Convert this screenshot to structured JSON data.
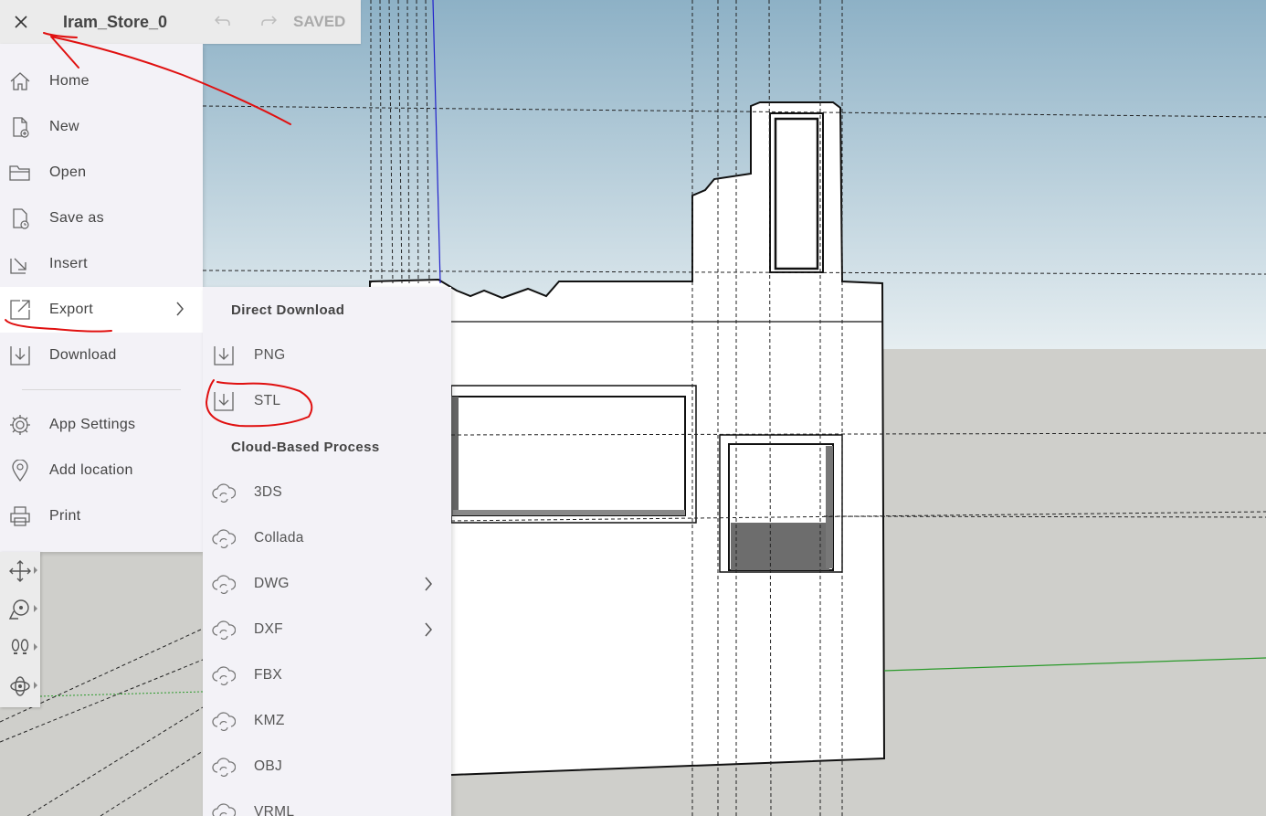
{
  "document": {
    "title": "Iram_Store_0",
    "status": "SAVED"
  },
  "toolbar": {
    "close_icon": "close-icon",
    "undo_icon": "undo-icon",
    "redo_icon": "redo-icon"
  },
  "file_menu": {
    "items": [
      {
        "label": "Home",
        "icon": "home-icon"
      },
      {
        "label": "New",
        "icon": "new-file-icon"
      },
      {
        "label": "Open",
        "icon": "folder-icon"
      },
      {
        "label": "Save as",
        "icon": "save-as-icon"
      },
      {
        "label": "Insert",
        "icon": "insert-icon"
      },
      {
        "label": "Export",
        "icon": "export-icon",
        "active": true
      },
      {
        "label": "Download",
        "icon": "download-icon"
      },
      {
        "label": "App Settings",
        "icon": "gear-icon"
      },
      {
        "label": "Add location",
        "icon": "location-pin-icon"
      },
      {
        "label": "Print",
        "icon": "printer-icon"
      }
    ]
  },
  "export_menu": {
    "direct_header": "Direct Download",
    "direct_items": [
      {
        "label": "PNG",
        "icon": "download-icon"
      },
      {
        "label": "STL",
        "icon": "download-icon"
      }
    ],
    "cloud_header": "Cloud-Based Process",
    "cloud_items": [
      {
        "label": "3DS",
        "icon": "cloud-process-icon"
      },
      {
        "label": "Collada",
        "icon": "cloud-process-icon"
      },
      {
        "label": "DWG",
        "icon": "cloud-process-icon",
        "submenu": true
      },
      {
        "label": "DXF",
        "icon": "cloud-process-icon",
        "submenu": true
      },
      {
        "label": "FBX",
        "icon": "cloud-process-icon"
      },
      {
        "label": "KMZ",
        "icon": "cloud-process-icon"
      },
      {
        "label": "OBJ",
        "icon": "cloud-process-icon"
      },
      {
        "label": "VRML",
        "icon": "cloud-process-icon"
      }
    ]
  },
  "tool_palette": [
    "move-icon",
    "tape-measure-icon",
    "walk-icon",
    "orbit-icon"
  ],
  "colors": {
    "sky_top": "#93b6c8",
    "sky_bottom": "#e2ebef",
    "ground": "#cfcfcb",
    "annotation": "#e01010",
    "blue_axis": "#2222cc",
    "green_axis": "#2a9a2a"
  }
}
